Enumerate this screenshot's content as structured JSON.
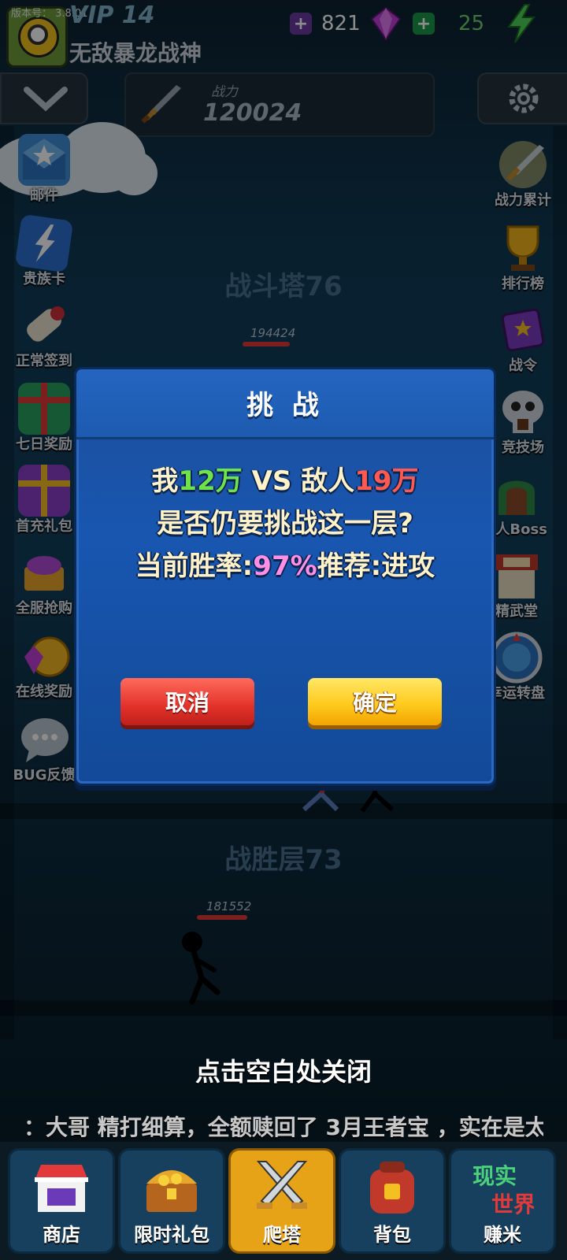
{
  "version_label": "版本号： 3.8.01",
  "player": {
    "vip": "VIP 14",
    "name": "无敌暴龙战神"
  },
  "currency": {
    "gems": "821",
    "energy": "25"
  },
  "power": {
    "label": "战力",
    "value": "120024"
  },
  "left_menu": [
    {
      "label": "邮件",
      "icon": "mail-icon"
    },
    {
      "label": "贵族卡",
      "icon": "noble-card-icon"
    },
    {
      "label": "正常签到",
      "icon": "scroll-icon"
    },
    {
      "label": "七日奖励",
      "icon": "gift-icon"
    },
    {
      "label": "首充礼包",
      "icon": "gift-purple-icon"
    },
    {
      "label": "全服抢购",
      "icon": "chest-icon"
    },
    {
      "label": "在线奖励",
      "icon": "clock-icon"
    },
    {
      "label": "BUG反馈",
      "icon": "chat-bubble-icon"
    }
  ],
  "right_menu": [
    {
      "label": "战力累计",
      "icon": "sword-icon"
    },
    {
      "label": "排行榜",
      "icon": "trophy-icon"
    },
    {
      "label": "战令",
      "icon": "book-icon"
    },
    {
      "label": "竞技场",
      "icon": "skull-icon"
    },
    {
      "label": "F人Boss",
      "icon": "door-icon"
    },
    {
      "label": "精武堂",
      "icon": "dojo-icon"
    },
    {
      "label": "幸运转盘",
      "icon": "wheel-icon"
    }
  ],
  "tower": {
    "upper_floor": "战斗塔76",
    "upper_enemy_power": "194424",
    "lower_floor": "战胜层73",
    "lower_power": "181552"
  },
  "dialog": {
    "title": "挑 战",
    "line1": {
      "me": "我",
      "my_power": "12万",
      "vs": " VS 敌人",
      "enemy_power": "19万"
    },
    "line2": "是否仍要挑战这一层?",
    "line3": {
      "win_label": "当前胜率:",
      "win_rate": "97%",
      "rec_label": "推荐:进攻"
    },
    "cancel": "取消",
    "confirm": "确定"
  },
  "close_hint": "点击空白处关闭",
  "marquee": "：大哥 精打细算，全额赎回了 3月王者宝 ，实在是太",
  "bottom_nav": [
    {
      "label": "商店",
      "icon": "shop-icon"
    },
    {
      "label": "限时礼包",
      "icon": "treasure-icon"
    },
    {
      "label": "爬塔",
      "icon": "crossed-swords-icon",
      "active": true
    },
    {
      "label": "背包",
      "icon": "backpack-icon"
    },
    {
      "label": "赚米",
      "icon": "real-world-icon",
      "icon_text": "现实世界"
    }
  ]
}
